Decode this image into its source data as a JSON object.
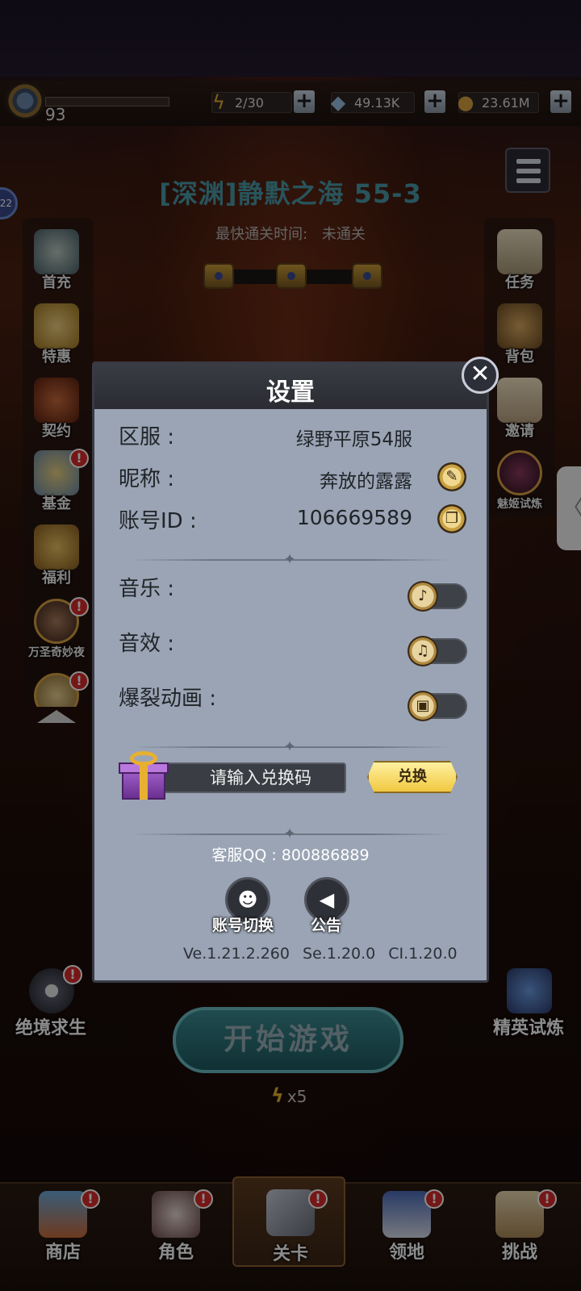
{
  "resources": {
    "level": "93",
    "energy": "2/30",
    "gems": "49.13K",
    "coins": "23.61M",
    "energy_icon": "lightning-icon",
    "gem_icon": "diamond-icon",
    "coin_icon": "coin-icon",
    "plus": "+"
  },
  "stage": {
    "title": "[深渊]静默之海 55-3",
    "fastest_label": "最快通关时间:",
    "fastest_value": "未通关"
  },
  "left_menu": [
    {
      "label": "首充",
      "badge": ""
    },
    {
      "label": "特惠",
      "badge": ""
    },
    {
      "label": "契约",
      "badge": ""
    },
    {
      "label": "基金",
      "badge": "!"
    },
    {
      "label": "福利",
      "badge": ""
    },
    {
      "label": "万圣奇妙夜",
      "badge": "!"
    },
    {
      "label": "",
      "badge": "!"
    }
  ],
  "right_menu": [
    {
      "label": "任务"
    },
    {
      "label": "背包"
    },
    {
      "label": "邀请"
    },
    {
      "label": "魅姬试炼"
    }
  ],
  "edge_avatar": "22",
  "edge_tab": "〈",
  "settings": {
    "title": "设置",
    "close": "✕",
    "server_label": "区服 :",
    "server_value": "绿野平原54服",
    "nickname_label": "昵称 :",
    "nickname_value": "奔放的露露",
    "account_label": "账号ID :",
    "account_value": "106669589",
    "music_label": "音乐 :",
    "sfx_label": "音效 :",
    "burst_label": "爆裂动画 :",
    "music_on": false,
    "sfx_on": false,
    "burst_on": false,
    "code_placeholder": "请输入兑换码",
    "redeem_label": "兑换",
    "qq_line": "客服QQ : 800886889",
    "switch_account_label": "账号切换",
    "notice_label": "公告",
    "version_text": "Ve.1.21.2.260  Se.1.20.0  CI.1.20.0",
    "divider_glyph": "✦",
    "edit_glyph": "✎",
    "copy_glyph": "❐",
    "music_glyph": "♪",
    "sfx_glyph": "♫",
    "burst_glyph": "▣",
    "switch_glyph": "☻",
    "notice_glyph": "◀"
  },
  "bottom": {
    "start_label": "开始游戏",
    "energy_cost_icon": "ϟ",
    "energy_cost": "x5",
    "left_mode": "绝境求生",
    "right_mode": "精英试炼"
  },
  "navbar": [
    {
      "label": "商店",
      "badge": "!",
      "active": false
    },
    {
      "label": "角色",
      "badge": "!",
      "active": false
    },
    {
      "label": "关卡",
      "badge": "!",
      "active": true
    },
    {
      "label": "领地",
      "badge": "!",
      "active": false
    },
    {
      "label": "挑战",
      "badge": "!",
      "active": false
    }
  ],
  "colors": {
    "modal_bg": "#9aa4b4",
    "stage_title": "#4a9aa8",
    "badge_red": "#d82a2a",
    "gold": "#e8b030"
  }
}
